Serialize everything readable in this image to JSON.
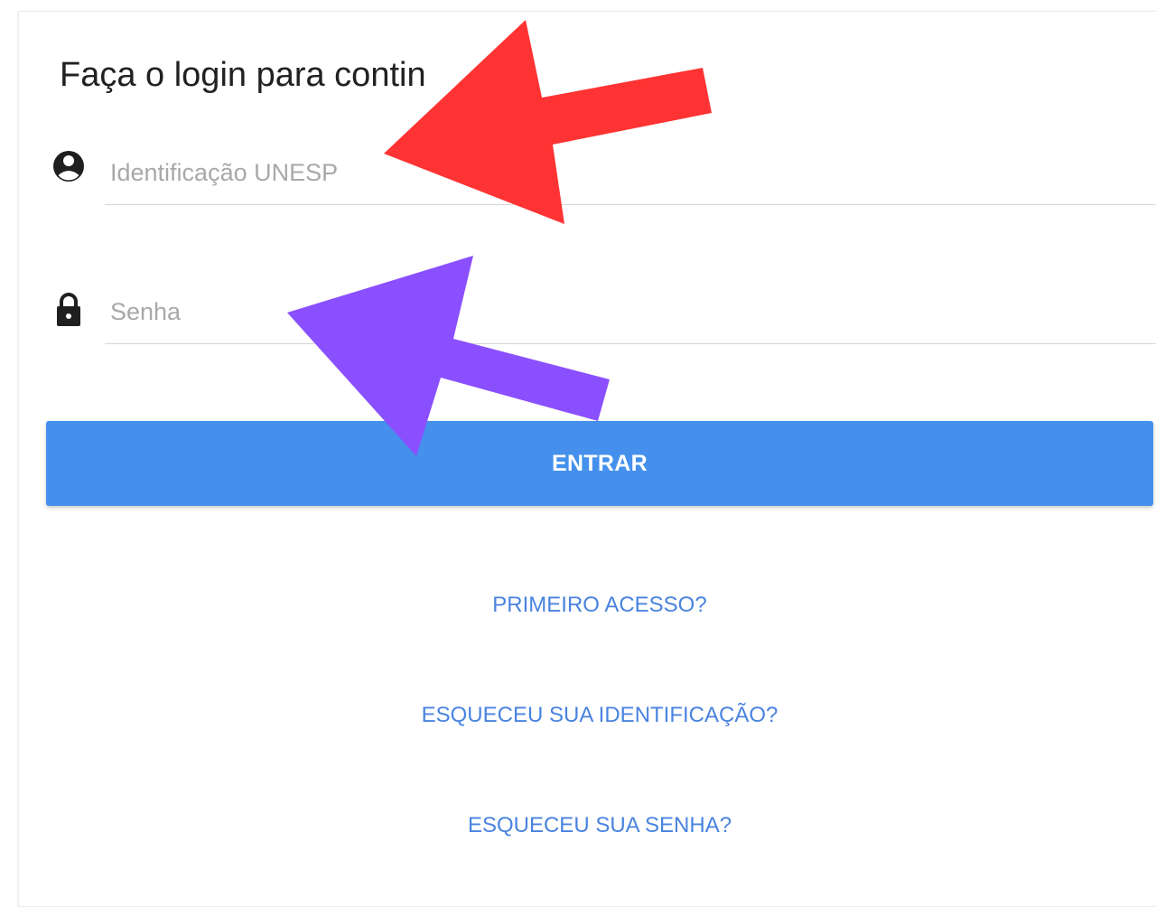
{
  "login": {
    "title": "Faça o login para contin",
    "username": {
      "icon": "account-circle-icon",
      "placeholder": "Identificação UNESP",
      "value": ""
    },
    "password": {
      "icon": "lock-icon",
      "placeholder": "Senha",
      "value": ""
    },
    "submit_label": "ENTRAR",
    "links": {
      "first_access": "PRIMEIRO ACESSO?",
      "forgot_id": "ESQUECEU SUA IDENTIFICAÇÃO?",
      "forgot_password": "ESQUECEU SUA SENHA?"
    }
  },
  "annotations": {
    "arrow_top": {
      "color": "#ff3333",
      "points_to": "username-field"
    },
    "arrow_bottom": {
      "color": "#8a4fff",
      "points_to": "password-field"
    }
  },
  "colors": {
    "primary_button": "#4490ec",
    "link": "#4a83df",
    "field_underline": "#d6d6d6"
  }
}
